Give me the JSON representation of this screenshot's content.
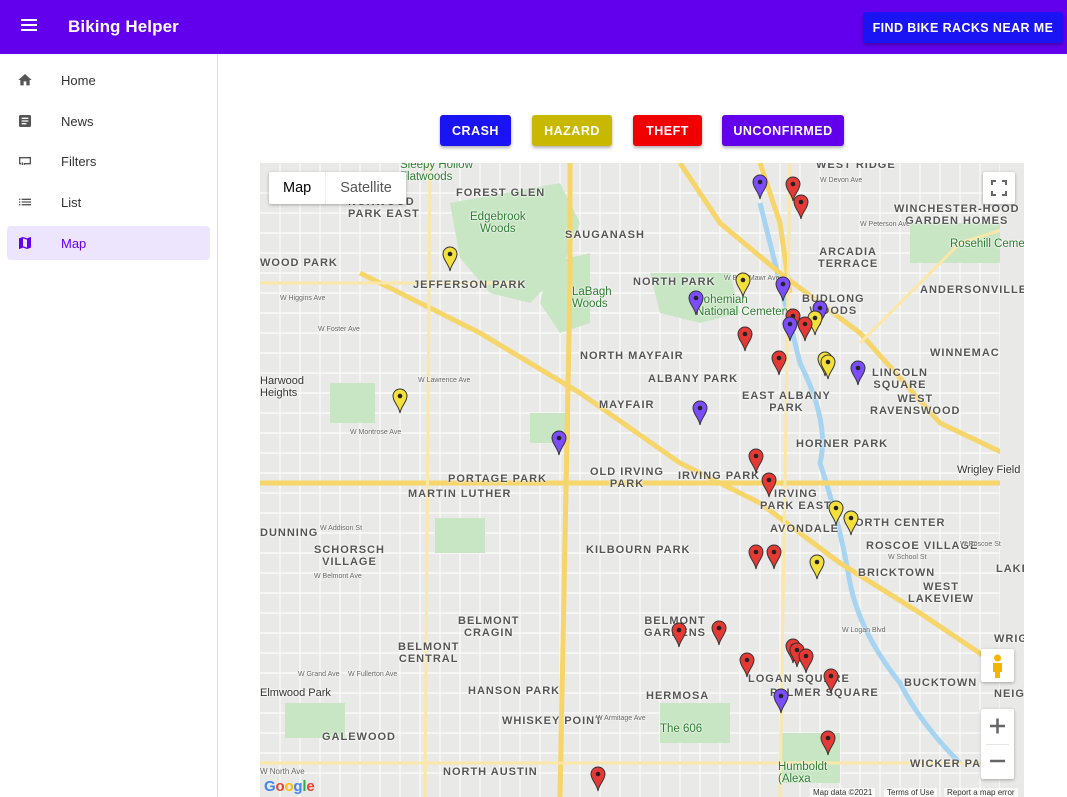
{
  "app": {
    "title": "Biking Helper",
    "find_button": "FIND BIKE RACKS NEAR ME"
  },
  "sidebar": {
    "items": [
      {
        "label": "Home",
        "icon": "home-icon"
      },
      {
        "label": "News",
        "icon": "news-icon"
      },
      {
        "label": "Filters",
        "icon": "filters-icon"
      },
      {
        "label": "List",
        "icon": "list-icon"
      },
      {
        "label": "Map",
        "icon": "map-icon",
        "active": true
      }
    ]
  },
  "filters": [
    {
      "label": "CRASH",
      "color": "#1a13f3"
    },
    {
      "label": "HAZARD",
      "color": "#c9b800"
    },
    {
      "label": "THEFT",
      "color": "#f10000"
    },
    {
      "label": "UNCONFIRMED",
      "color": "#6200ee"
    }
  ],
  "map": {
    "type_map": "Map",
    "type_satellite": "Satellite",
    "footer": {
      "data": "Map data ©2021",
      "terms": "Terms of Use",
      "report": "Report a map error"
    },
    "logo": "Google",
    "labels": {
      "forest_glen": "FOREST GLEN",
      "edgebrook": "Edgebrook\nWoods",
      "sauganash": "SAUGANASH",
      "sleepy": "Sleepy Hollow\nFlatwoods",
      "norwood": "NORWOOD\nPARK EAST",
      "wood_park": "WOOD PARK",
      "jefferson": "JEFFERSON PARK",
      "north_park": "NORTH PARK",
      "labagh": "LaBagh\nWoods",
      "bohemian": "Bohemian\nNational Cemetery",
      "budlong": "BUDLONG\nWOODS",
      "west_ridge": "WEST RIDGE",
      "winchester": "WINCHESTER-HOOD\nGARDEN HOMES",
      "arcadia": "ARCADIA\nTERRACE",
      "rosehill": "Rosehill Ceme",
      "andersonville": "ANDERSONVILLE",
      "winnemac": "WINNEMAC",
      "north_mayfair": "NORTH MAYFAIR",
      "albany_park": "ALBANY PARK",
      "lincoln_square": "LINCOLN\nSQUARE",
      "east_albany": "EAST ALBANY\nPARK",
      "west_ravenswood": "WEST\nRAVENSWOOD",
      "harwood": "Harwood\nHeights",
      "mayfair": "MAYFAIR",
      "horner": "HORNER PARK",
      "old_irving": "OLD IRVING\nPARK",
      "portage": "PORTAGE PARK",
      "irving_park": "IRVING PARK",
      "martin_luther": "MARTIN LUTHER",
      "irving_park_east": "IRVING\nPARK EAST",
      "wrigley": "Wrigley Field",
      "dunning": "DUNNING",
      "schorsch": "SCHORSCH\nVILLAGE",
      "kilbourn": "KILBOURN PARK",
      "north_center": "NORTH CENTER",
      "roscoe": "ROSCOE VILLAGE",
      "avondale": "AVONDALE",
      "bricktown": "BRICKTOWN",
      "lake": "LAKE",
      "west_lakeview": "WEST\nLAKEVIEW",
      "belmont_cragin": "BELMONT\nCRAGIN",
      "belmont_gardens": "BELMONT\nGARDENS",
      "belmont_central": "BELMONT\nCENTRAL",
      "wrigh": "WRIGH",
      "neigh": "NEIGH",
      "elmwood": "Elmwood Park",
      "hanson": "HANSON PARK",
      "hermosa": "HERMOSA",
      "logan_square": "LOGAN SQUARE",
      "palmer": "PALMER SQUARE",
      "bucktown": "BUCKTOWN",
      "galewood": "GALEWOOD",
      "whiskey": "WHISKEY POINT",
      "the606": "The 606",
      "north_austin": "NORTH AUSTIN",
      "wicker": "WICKER PARK",
      "humboldt": "Humboldt\n(Alexa",
      "w_north_ave": "W North Ave",
      "w_devon": "W Devon Ave",
      "w_foster": "W Foster Ave",
      "w_lawrence": "W Lawrence Ave",
      "w_montrose": "W Montrose Ave",
      "w_addison": "W Addison St",
      "w_belmont": "W Belmont Ave",
      "w_fullerton": "W Fullerton Ave",
      "w_grand": "W Grand Ave",
      "w_roscoe": "W Roscoe St",
      "w_school": "W School St",
      "w_logan": "W Logan Blvd",
      "w_armitage": "W Armitage Ave",
      "w_higgins": "W Higgins Ave",
      "w_bryn_mawr": "W Bryn Mawr Ave",
      "w_peterson": "W Peterson Ave"
    },
    "markers": [
      {
        "type": "unconfirmed",
        "color": "#7c4dff"
      },
      {
        "type": "theft",
        "color": "#e53935"
      },
      {
        "type": "theft",
        "color": "#e53935"
      },
      {
        "type": "hazard",
        "color": "#f4e03a"
      },
      {
        "type": "unconfirmed",
        "color": "#7c4dff"
      },
      {
        "type": "hazard",
        "color": "#f4e03a"
      },
      {
        "type": "unconfirmed",
        "color": "#7c4dff"
      },
      {
        "type": "unconfirmed",
        "color": "#7c4dff"
      },
      {
        "type": "theft",
        "color": "#e53935"
      },
      {
        "type": "hazard",
        "color": "#f4e03a"
      },
      {
        "type": "theft",
        "color": "#e53935"
      },
      {
        "type": "unconfirmed",
        "color": "#7c4dff"
      },
      {
        "type": "theft",
        "color": "#e53935"
      },
      {
        "type": "theft",
        "color": "#e53935"
      },
      {
        "type": "hazard",
        "color": "#f4e03a"
      },
      {
        "type": "hazard",
        "color": "#f4e03a"
      },
      {
        "type": "unconfirmed",
        "color": "#7c4dff"
      },
      {
        "type": "hazard",
        "color": "#f4e03a"
      },
      {
        "type": "unconfirmed",
        "color": "#7c4dff"
      },
      {
        "type": "unconfirmed",
        "color": "#7c4dff"
      },
      {
        "type": "theft",
        "color": "#e53935"
      },
      {
        "type": "theft",
        "color": "#e53935"
      },
      {
        "type": "hazard",
        "color": "#f4e03a"
      },
      {
        "type": "hazard",
        "color": "#f4e03a"
      },
      {
        "type": "theft",
        "color": "#e53935"
      },
      {
        "type": "theft",
        "color": "#e53935"
      },
      {
        "type": "hazard",
        "color": "#f4e03a"
      },
      {
        "type": "theft",
        "color": "#e53935"
      },
      {
        "type": "theft",
        "color": "#e53935"
      },
      {
        "type": "theft",
        "color": "#e53935"
      },
      {
        "type": "theft",
        "color": "#e53935"
      },
      {
        "type": "theft",
        "color": "#e53935"
      },
      {
        "type": "theft",
        "color": "#e53935"
      },
      {
        "type": "theft",
        "color": "#e53935"
      },
      {
        "type": "unconfirmed",
        "color": "#7c4dff"
      },
      {
        "type": "theft",
        "color": "#e53935"
      },
      {
        "type": "theft",
        "color": "#e53935"
      }
    ]
  }
}
